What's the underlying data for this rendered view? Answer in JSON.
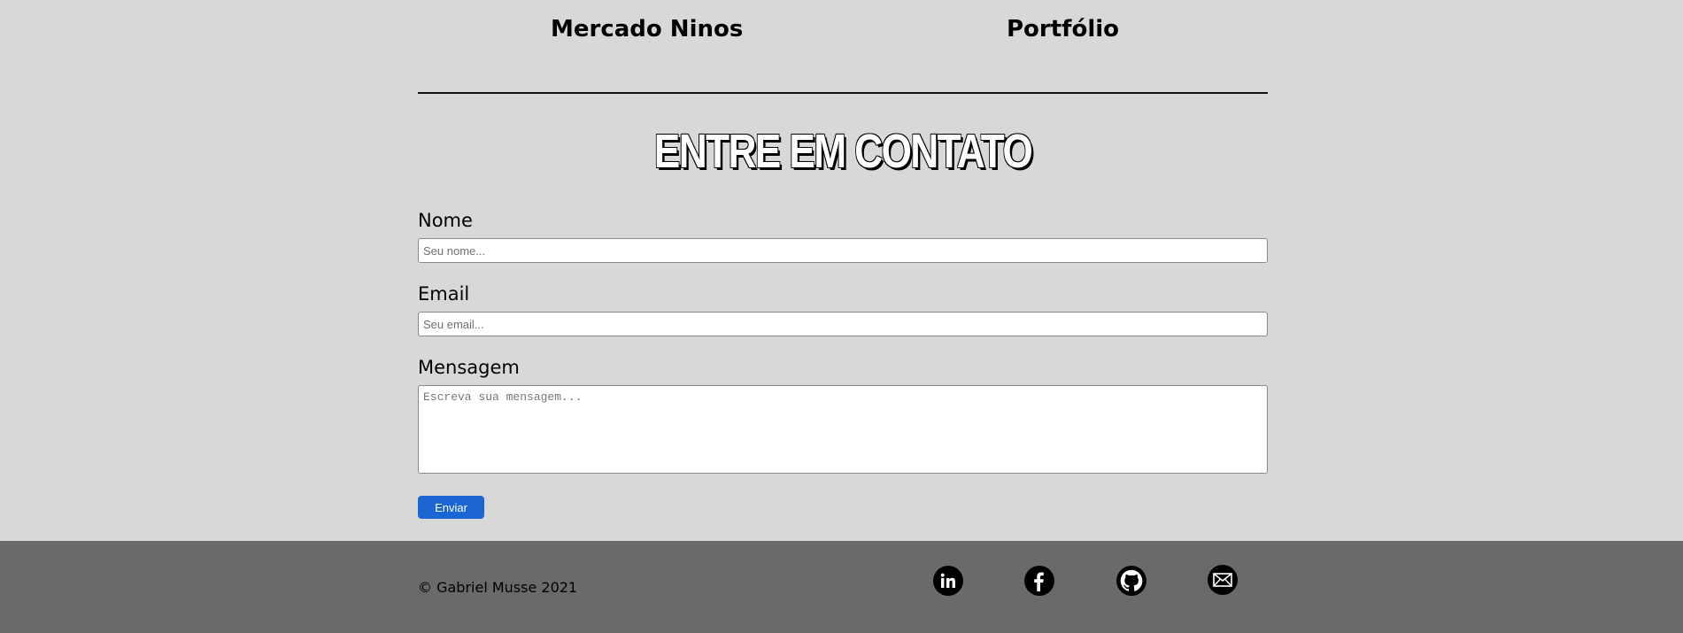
{
  "projects": [
    {
      "label": "Mercado Ninos"
    },
    {
      "label": "Portfólio"
    }
  ],
  "contact": {
    "title": "ENTRE EM CONTATO",
    "name_label": "Nome",
    "name_placeholder": "Seu nome...",
    "email_label": "Email",
    "email_placeholder": "Seu email...",
    "message_label": "Mensagem",
    "message_placeholder": "Escreva sua mensagem...",
    "submit_label": "Enviar"
  },
  "footer": {
    "copyright": "© Gabriel Musse 2021",
    "social": [
      {
        "icon": "linkedin-icon"
      },
      {
        "icon": "facebook-icon"
      },
      {
        "icon": "github-icon"
      },
      {
        "icon": "mail-icon"
      }
    ]
  },
  "colors": {
    "background": "#d8d8d8",
    "footer": "#6a6a6a",
    "button": "#1b66d2"
  }
}
